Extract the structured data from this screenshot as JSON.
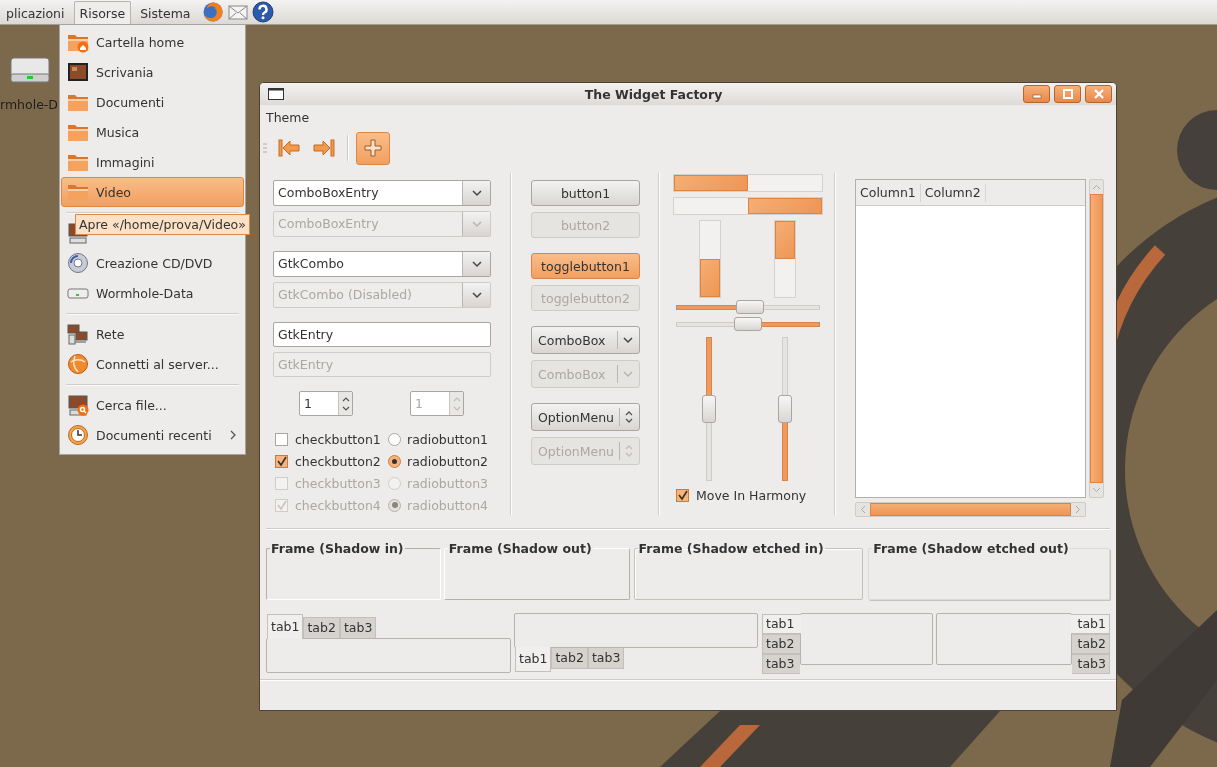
{
  "top_panel": {
    "menus": [
      {
        "label": "plicazioni",
        "selected": false
      },
      {
        "label": "Risorse",
        "selected": true
      },
      {
        "label": "Sistema",
        "selected": false
      }
    ],
    "launchers": [
      {
        "kind": "browser"
      },
      {
        "kind": "mail"
      },
      {
        "kind": "help"
      }
    ]
  },
  "desktop": {
    "icons": [
      {
        "label": "rmhole-D"
      }
    ]
  },
  "places_menu": {
    "items": [
      {
        "kind": "home",
        "label": "Cartella home",
        "selected": false,
        "submenu": false
      },
      {
        "kind": "desktop",
        "label": "Scrivania",
        "selected": false,
        "submenu": false
      },
      {
        "kind": "folder",
        "label": "Documenti",
        "selected": false,
        "submenu": false
      },
      {
        "kind": "folder",
        "label": "Musica",
        "selected": false,
        "submenu": false
      },
      {
        "kind": "folder",
        "label": "Immagini",
        "selected": false,
        "submenu": false
      },
      {
        "kind": "folder",
        "label": "Video",
        "selected": true,
        "submenu": false
      },
      {
        "kind": "separator"
      },
      {
        "kind": "computer",
        "selected": false,
        "submenu": false
      },
      {
        "kind": "disc",
        "label": "Creazione CD/DVD",
        "selected": false,
        "submenu": false
      },
      {
        "kind": "drive",
        "label": "Wormhole-Data",
        "selected": false,
        "submenu": false
      },
      {
        "kind": "separator"
      },
      {
        "kind": "network",
        "label": "Rete",
        "selected": false,
        "submenu": false
      },
      {
        "kind": "server",
        "label": "Connetti al server...",
        "selected": false,
        "submenu": false
      },
      {
        "kind": "separator"
      },
      {
        "kind": "search",
        "label": "Cerca file...",
        "selected": false,
        "submenu": false
      },
      {
        "kind": "recent",
        "label": "Documenti recenti",
        "selected": false,
        "submenu": true
      }
    ]
  },
  "tooltip": {
    "text": "Apre «/home/prova/Video»"
  },
  "window": {
    "title": "The Widget Factory",
    "menubar": [
      {
        "label": "Theme"
      }
    ],
    "toolbar": [
      {
        "kind": "back",
        "selected": false
      },
      {
        "kind": "forward",
        "selected": false
      },
      {
        "kind": "add",
        "selected": true
      }
    ],
    "fields": [
      {
        "kind": "combo_entry",
        "value": "ComboBoxEntry",
        "disabled": false
      },
      {
        "kind": "combo_entry",
        "value": "ComboBoxEntry",
        "disabled": true
      },
      {
        "kind": "combo",
        "value": "GtkCombo",
        "disabled": false
      },
      {
        "kind": "combo",
        "value": "GtkCombo (Disabled)",
        "disabled": true
      },
      {
        "kind": "entry",
        "value": "GtkEntry",
        "disabled": false
      },
      {
        "kind": "entry",
        "value": "GtkEntry",
        "disabled": true
      }
    ],
    "spinners": [
      {
        "value": "1",
        "disabled": false
      },
      {
        "value": "1",
        "disabled": true
      }
    ],
    "checks": [
      {
        "label": "checkbutton1",
        "checked": false,
        "disabled": false
      },
      {
        "label": "checkbutton2",
        "checked": true,
        "disabled": false
      },
      {
        "label": "checkbutton3",
        "checked": false,
        "disabled": true
      },
      {
        "label": "checkbutton4",
        "checked": true,
        "disabled": true
      }
    ],
    "radios": [
      {
        "label": "radiobutton1",
        "selected": false,
        "disabled": false
      },
      {
        "label": "radiobutton2",
        "selected": true,
        "disabled": false
      },
      {
        "label": "radiobutton3",
        "selected": false,
        "disabled": true
      },
      {
        "label": "radiobutton4",
        "selected": true,
        "disabled": true
      }
    ],
    "buttons": [
      {
        "kind": "button",
        "label": "button1",
        "disabled": false
      },
      {
        "kind": "button",
        "label": "button2",
        "disabled": true
      },
      {
        "kind": "toggle",
        "label": "togglebutton1",
        "on": true,
        "disabled": false
      },
      {
        "kind": "toggle",
        "label": "togglebutton2",
        "on": false,
        "disabled": true
      },
      {
        "kind": "combobox",
        "label": "ComboBox",
        "disabled": false
      },
      {
        "kind": "combobox",
        "label": "ComboBox",
        "disabled": true
      },
      {
        "kind": "optionmenu",
        "label": "OptionMenu",
        "disabled": false
      },
      {
        "kind": "optionmenu",
        "label": "OptionMenu",
        "disabled": true
      }
    ],
    "progress_bars": [
      {
        "kind": "left",
        "level": 0.5
      },
      {
        "kind": "right",
        "level": 0.5
      },
      {
        "kind": "bottom",
        "level": 0.5
      },
      {
        "kind": "top",
        "level": 0.5
      }
    ],
    "scales": [
      {
        "kind": "left",
        "level": 0.52
      },
      {
        "kind": "right",
        "level": 0.5
      },
      {
        "kind": "top",
        "level": 0.5
      },
      {
        "kind": "bottom",
        "level": 0.5
      }
    ],
    "harmony": {
      "label": "Move In Harmony",
      "checked": true
    },
    "tree": {
      "columns": [
        "Column1",
        "Column2"
      ]
    },
    "frames": [
      {
        "label": "Frame (Shadow in)",
        "kind": "in"
      },
      {
        "label": "Frame (Shadow out)",
        "kind": "out"
      },
      {
        "label": "Frame (Shadow etched in)",
        "kind": "etched_in"
      },
      {
        "label": "Frame (Shadow etched out)",
        "kind": "etched_out"
      }
    ],
    "notebooks": [
      {
        "kind": "top",
        "tabs": [
          {
            "label": "tab1",
            "selected": true
          },
          {
            "label": "tab2",
            "selected": false
          },
          {
            "label": "tab3",
            "selected": false
          }
        ]
      },
      {
        "kind": "bottom",
        "tabs": [
          {
            "label": "tab1",
            "selected": true
          },
          {
            "label": "tab2",
            "selected": false
          },
          {
            "label": "tab3",
            "selected": false
          }
        ]
      },
      {
        "kind": "left",
        "tabs": [
          {
            "label": "tab1",
            "selected": true
          },
          {
            "label": "tab2",
            "selected": false
          },
          {
            "label": "tab3",
            "selected": false
          }
        ]
      },
      {
        "kind": "right",
        "tabs": [
          {
            "label": "tab1",
            "selected": true
          },
          {
            "label": "tab2",
            "selected": false
          },
          {
            "label": "tab3",
            "selected": false
          }
        ]
      }
    ]
  }
}
